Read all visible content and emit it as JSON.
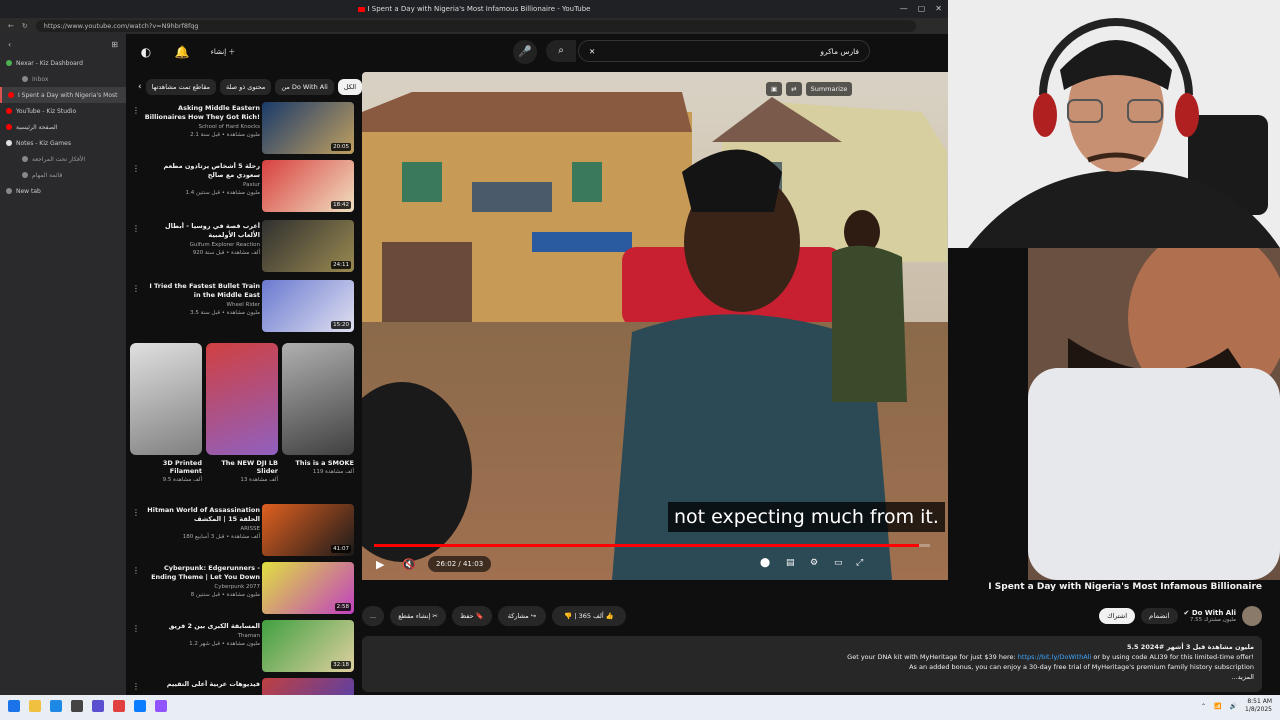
{
  "browser": {
    "window_title": "I Spent a Day with Nigeria's Most Infamous Billionaire - YouTube",
    "url": "https://www.youtube.com/watch?v=N9hbrf8fqg",
    "window_controls": [
      "—",
      "▢",
      "✕"
    ]
  },
  "sidebar": {
    "tabs": [
      {
        "label": "Nexar - Kiz Dashboard",
        "active": false,
        "color": "#4caf50"
      },
      {
        "label": "Inbox",
        "active": false,
        "sub": true,
        "color": "#888"
      },
      {
        "label": "I Spent a Day with Nigeria's Most",
        "active": true,
        "color": "#ff0000"
      },
      {
        "label": "YouTube - Kiz Studio",
        "active": false,
        "color": "#ff0000"
      },
      {
        "label": "الصفحة الرئيسية",
        "active": false,
        "color": "#ff0000"
      },
      {
        "label": "Notes - Kiz Games",
        "active": false,
        "color": "#e0e0e0"
      },
      {
        "label": "الأفكار تحت المراجعة",
        "active": false,
        "sub": true,
        "color": "#888"
      },
      {
        "label": "قائمة المهام",
        "active": false,
        "sub": true,
        "color": "#888"
      },
      {
        "label": "New tab",
        "active": false,
        "color": "#888"
      }
    ]
  },
  "header": {
    "search_value": "فارس ماكرو",
    "create_label": "إنشاء"
  },
  "chips": [
    "الكل",
    "من Do With Ali",
    "محتوى ذو صلة",
    "مقاطع تمت مشاهدتها"
  ],
  "recommendations": [
    {
      "title": "Asking Middle Eastern Billionaires How They Got Rich!",
      "channel": "School of Hard Knocks",
      "stats": "2.1 مليون مشاهدة • قبل سنة",
      "duration": "20:05",
      "colors": [
        "#1a3a6a",
        "#c0a060"
      ]
    },
    {
      "title": "رحلة 5 أشخاص يرتادون مطعم سعودي مع صالح",
      "channel": "Paxiur",
      "stats": "1.4 مليون مشاهدة • قبل سنتين",
      "duration": "18:42",
      "colors": [
        "#d84040",
        "#f0e0c0"
      ]
    },
    {
      "title": "أغرب قصة في روسيا - أبطال الألعاب الأولمبية",
      "channel": "Gulfum Explorer Reaction",
      "stats": "920 ألف مشاهدة • قبل سنة",
      "duration": "24:11",
      "colors": [
        "#303030",
        "#9a8a50"
      ]
    },
    {
      "title": "I Tried the Fastest Bullet Train in the Middle East",
      "channel": "Wheel Rider",
      "stats": "3.5 مليون مشاهدة • قبل سنة",
      "duration": "15:20",
      "colors": [
        "#6a7ad0",
        "#e0e0f0"
      ]
    },
    {
      "title": "Hitman World of Assassination الحلقة 15 | المكشف",
      "channel": "ARISSE",
      "stats": "180 ألف مشاهدة • قبل 3 أسابيع",
      "duration": "41:07",
      "colors": [
        "#e06020",
        "#1a1a1a"
      ]
    },
    {
      "title": "Cyberpunk: Edgerunners - Ending Theme | Let You Down",
      "channel": "Cyberpunk 2077",
      "stats": "8 مليون مشاهدة • قبل سنتين",
      "duration": "2:58",
      "colors": [
        "#e0e040",
        "#c040c0"
      ]
    },
    {
      "title": "المسابقة الكبرى بين 2 فريق",
      "channel": "Thaman",
      "stats": "1.2 مليون مشاهدة • قبل شهر",
      "duration": "32:18",
      "colors": [
        "#40a040",
        "#e0d0a0"
      ]
    },
    {
      "title": "فيديوهات عربية أعلى التقييم",
      "channel": "",
      "stats": "",
      "duration": "",
      "colors": [
        "#c04040",
        "#4040c0"
      ]
    }
  ],
  "shorts": [
    {
      "title": "This is a SMOKE",
      "stats": "119 ألف مشاهدة",
      "colors": [
        "#b0b0b0",
        "#404040"
      ]
    },
    {
      "title": "The NEW DJI LB Slider",
      "stats": "13 ألف مشاهدة",
      "colors": [
        "#d04040",
        "#9060c0"
      ]
    },
    {
      "title": "3D Printed Filament",
      "stats": "9.5 ألف مشاهدة",
      "colors": [
        "#e0e0e0",
        "#808080"
      ]
    }
  ],
  "player": {
    "subtitle": "not expecting much from it.",
    "time": "26:02 / 41:03",
    "progress": 0.98,
    "overlay_buttons": [
      "Summarize"
    ]
  },
  "video": {
    "title": "I Spent a Day with Nigeria's Most Infamous Billionaire",
    "channel": "Do With Ali",
    "subscribers": "7.55 مليون مشترك",
    "subscribe_label": "اشتراك",
    "join_label": "انضمام",
    "likes": "365 ألف",
    "share_label": "مشاركة",
    "save_label": "حفظ",
    "clip_label": "إنشاء مقطع",
    "more_label": "..."
  },
  "description": {
    "stats": "5.5 مليون مشاهدة  قبل 3 أشهر  #2024",
    "line1_prefix": "Get your DNA kit with MyHeritage for just $39 here:",
    "line1_link": "https://bit.ly/DoWithAli",
    "line1_suffix": "or by using code ALI39 for this limited-time offer!",
    "line2": "As an added bonus, you can enjoy a 30-day free trial of MyHeritage's premium family history subscription",
    "more": "...المزيد"
  },
  "taskbar": {
    "time": "8:51 AM",
    "date": "1/8/2025"
  }
}
